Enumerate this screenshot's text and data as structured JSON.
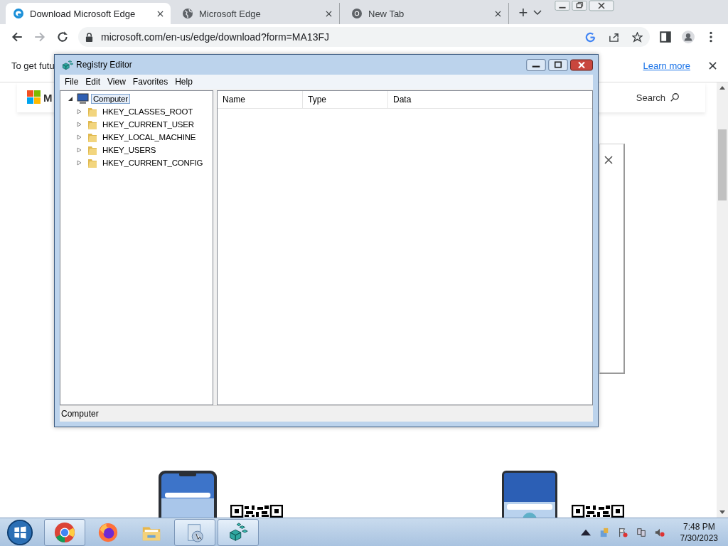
{
  "browser": {
    "tabs": [
      {
        "title": "Download Microsoft Edge",
        "kind": "edge",
        "selected": true
      },
      {
        "title": "Microsoft Edge",
        "kind": "globe",
        "selected": false
      },
      {
        "title": "New Tab",
        "kind": "chrome",
        "selected": false
      }
    ],
    "new_tab": "+",
    "address": "microsoft.com/en-us/edge/download?form=MA13FJ"
  },
  "infobar": {
    "text": "To get futu",
    "link": "Learn more"
  },
  "page": {
    "brand": "M",
    "search": "Search"
  },
  "registry_editor": {
    "title": "Registry Editor",
    "menu": [
      "File",
      "Edit",
      "View",
      "Favorites",
      "Help"
    ],
    "tree": {
      "label": "Computer",
      "selected": true,
      "expanded": true,
      "children": [
        {
          "label": "HKEY_CLASSES_ROOT",
          "expanded": false
        },
        {
          "label": "HKEY_CURRENT_USER",
          "expanded": false
        },
        {
          "label": "HKEY_LOCAL_MACHINE",
          "expanded": false
        },
        {
          "label": "HKEY_USERS",
          "expanded": false
        },
        {
          "label": "HKEY_CURRENT_CONFIG",
          "expanded": false
        }
      ]
    },
    "columns": [
      "Name",
      "Type",
      "Data"
    ],
    "status_bar": "Computer"
  },
  "taskbar": {
    "apps": [
      {
        "kind": "chrome",
        "running": true
      },
      {
        "kind": "firefox",
        "running": false
      },
      {
        "kind": "explorer",
        "running": false
      },
      {
        "kind": "installer",
        "running": true
      },
      {
        "kind": "regedit",
        "running": true
      }
    ],
    "time": "7:48 PM",
    "date": "7/30/2023"
  }
}
